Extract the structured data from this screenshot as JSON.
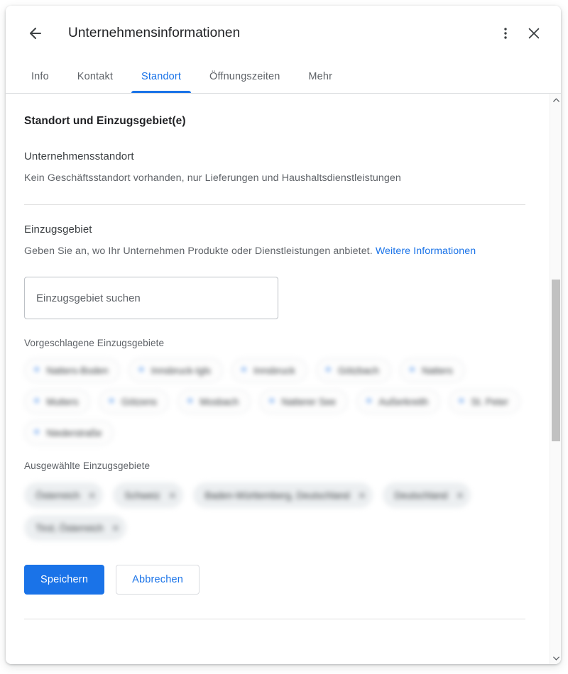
{
  "header": {
    "title": "Unternehmensinformationen",
    "back_icon": "back-arrow-icon",
    "overflow_icon": "more-vert-icon",
    "close_icon": "close-icon"
  },
  "tabs": [
    {
      "label": "Info",
      "active": false
    },
    {
      "label": "Kontakt",
      "active": false
    },
    {
      "label": "Standort",
      "active": true
    },
    {
      "label": "Öffnungszeiten",
      "active": false
    },
    {
      "label": "Mehr",
      "active": false
    }
  ],
  "content": {
    "section_title": "Standort und Einzugsgebiet(e)",
    "business_location": {
      "title": "Unternehmensstandort",
      "description": "Kein Geschäftsstandort vorhanden, nur Lieferungen und Haushaltsdienstleistungen"
    },
    "service_area": {
      "title": "Einzugsgebiet",
      "description": "Geben Sie an, wo Ihr Unternehmen Produkte oder Dienstleistungen anbietet.",
      "learn_more_label": "Weitere Informationen"
    },
    "search": {
      "placeholder": "Einzugsgebiet suchen",
      "value": ""
    },
    "suggested": {
      "label": "Vorgeschlagene Einzugsgebiete",
      "chips": [
        "Natters-Boden",
        "Innsbruck-Igls",
        "Innsbruck",
        "Götzbach",
        "Natters",
        "Mutters",
        "Götzens",
        "Mosbach",
        "Natterer See",
        "Außerkreith",
        "St. Peter",
        "Niederstraße"
      ]
    },
    "selected": {
      "label": "Ausgewählte Einzugsgebiete",
      "chips": [
        "Österreich",
        "Schweiz",
        "Baden-Württemberg, Deutschland",
        "Deutschland",
        "Tirol, Österreich"
      ],
      "remove_label": "✕"
    },
    "actions": {
      "save_label": "Speichern",
      "cancel_label": "Abbrechen"
    }
  },
  "colors": {
    "accent": "#1a73e8",
    "text_primary": "#202124",
    "text_secondary": "#5f6368",
    "border": "#dadce0"
  }
}
